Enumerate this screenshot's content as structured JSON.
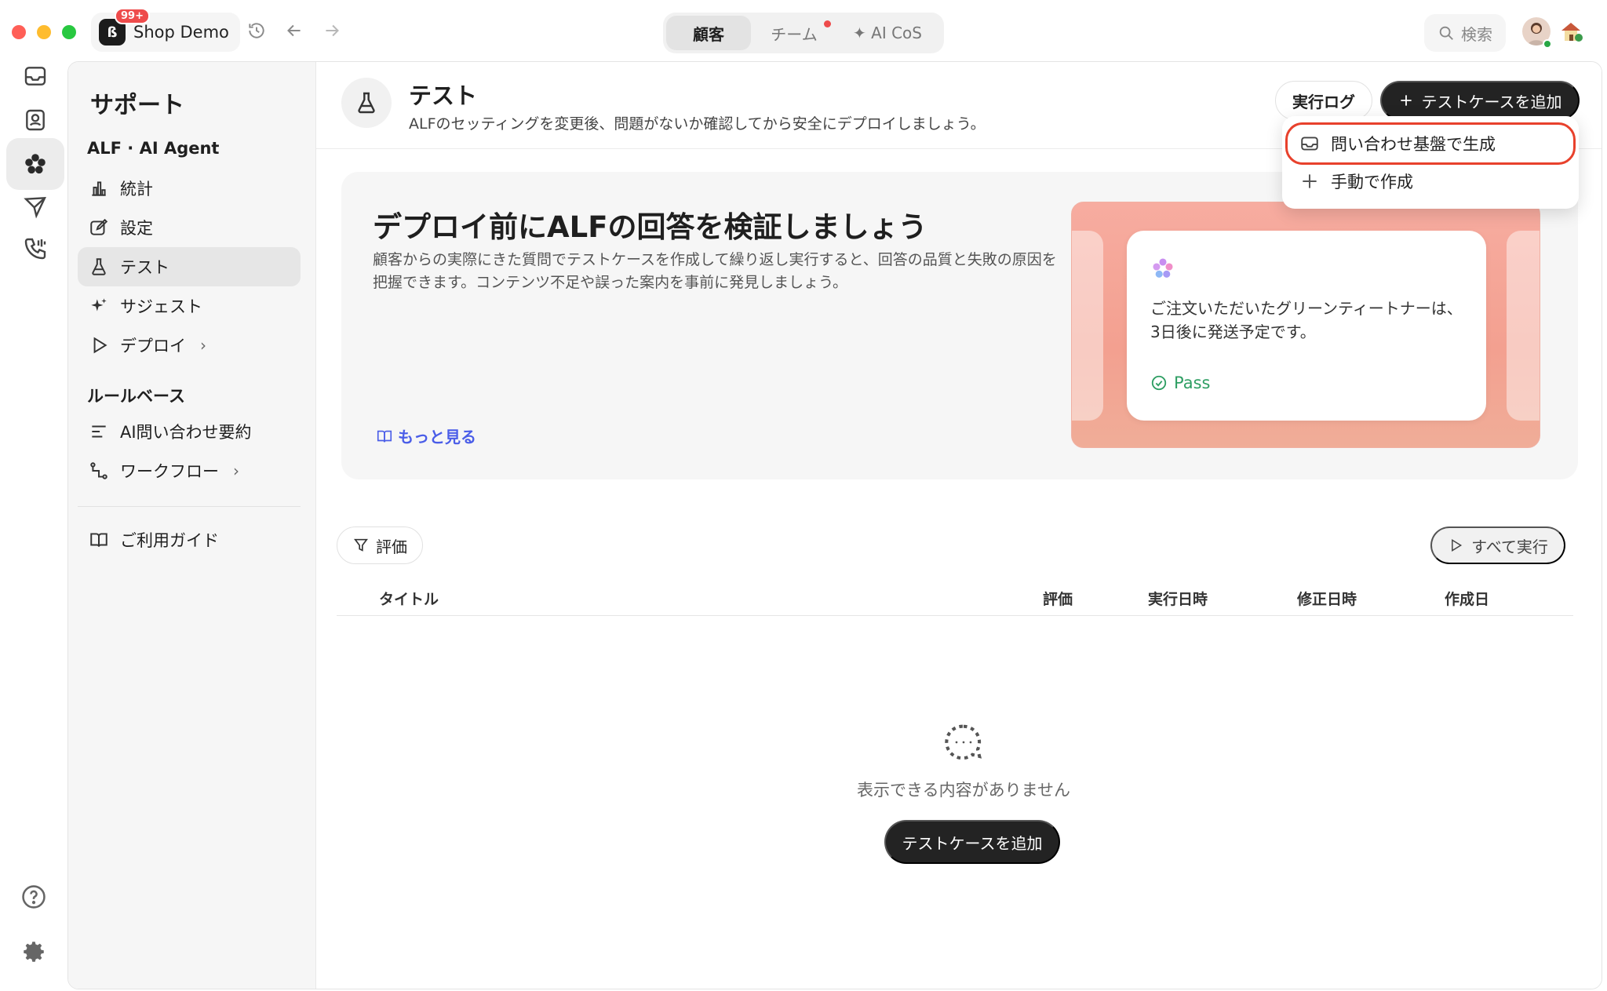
{
  "app": {
    "name": "Shop Demo",
    "badge": "99+",
    "logo_glyph": "ß"
  },
  "top_tabs": [
    {
      "label": "顧客",
      "active": true,
      "dot": false
    },
    {
      "label": "チーム",
      "active": false,
      "dot": true
    },
    {
      "label": "✦ AI CoS",
      "active": false,
      "dot": false
    }
  ],
  "search": {
    "label": "検索"
  },
  "sidebar": {
    "title": "サポート",
    "sections": [
      {
        "label": "ALF · AI Agent"
      },
      {
        "label": "ルールベース"
      }
    ],
    "items": [
      {
        "label": "統計",
        "icon": "bar-chart-icon"
      },
      {
        "label": "設定",
        "icon": "edit-icon"
      },
      {
        "label": "テスト",
        "icon": "flask-icon",
        "active": true
      },
      {
        "label": "サジェスト",
        "icon": "sparkle-icon"
      },
      {
        "label": "デプロイ",
        "icon": "play-icon",
        "chevron": "›"
      },
      {
        "label": "AI問い合わせ要約",
        "icon": "summary-lines-icon"
      },
      {
        "label": "ワークフロー",
        "icon": "workflow-icon",
        "chevron": "›"
      },
      {
        "label": "ご利用ガイド",
        "icon": "book-icon"
      }
    ]
  },
  "page": {
    "title": "テスト",
    "subtitle": "ALFのセッティングを変更後、問題がないか確認してから安全にデプロイしましょう。",
    "log_button": "実行ログ",
    "add_button": "テストケースを追加"
  },
  "dropdown": {
    "items": [
      {
        "label": "問い合わせ基盤で生成",
        "icon": "inbox-icon",
        "highlighted": true
      },
      {
        "label": "手動で作成",
        "icon": "plus-icon"
      }
    ]
  },
  "banner": {
    "title": "デプロイ前にALFの回答を検証しましょう",
    "description": "顧客からの実際にきた質問でテストケースを作成して繰り返し実行すると、回答の品質と失敗の原因を把握できます。コンテンツ不足や誤った案内を事前に発見しましょう。",
    "link": "もっと見る",
    "card_text": "ご注文いただいたグリーンティートナーは、3日後に発送予定です。",
    "card_status": "Pass"
  },
  "toolbar": {
    "filter": "評価",
    "run_all": "すべて実行"
  },
  "table": {
    "columns": [
      "タイトル",
      "評価",
      "実行日時",
      "修正日時",
      "作成日"
    ]
  },
  "empty": {
    "text": "表示できる内容がありません",
    "button": "テストケースを追加"
  },
  "colors": {
    "accent_dark": "#232323",
    "link_blue": "#4a5de8",
    "pass_green": "#2e9e63",
    "highlight_red": "#e8412c",
    "badge_red": "#ee4b4b"
  }
}
